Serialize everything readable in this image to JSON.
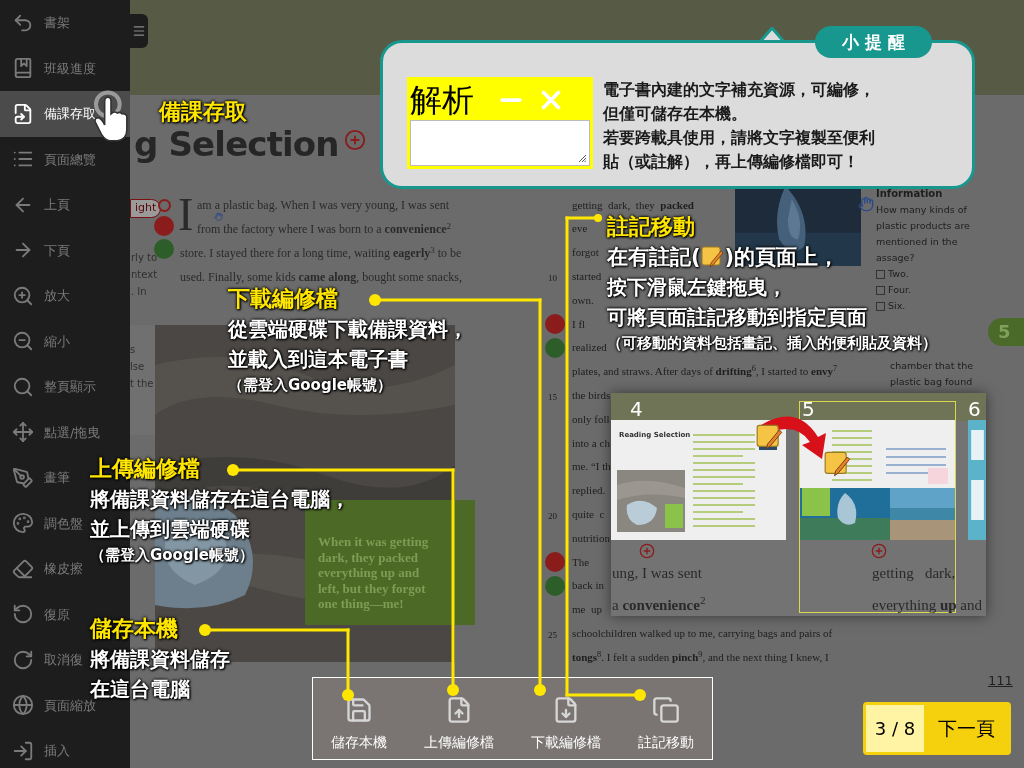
{
  "sidebar": {
    "items": [
      {
        "label": "書架",
        "selected": false
      },
      {
        "label": "班級進度",
        "selected": false
      },
      {
        "label": "備課存取",
        "selected": true
      },
      {
        "label": "頁面總覽",
        "selected": false
      },
      {
        "label": "上頁",
        "selected": false
      },
      {
        "label": "下頁",
        "selected": false
      },
      {
        "label": "放大",
        "selected": false
      },
      {
        "label": "縮小",
        "selected": false
      },
      {
        "label": "整頁顯示",
        "selected": false
      },
      {
        "label": "點選/拖曳",
        "selected": false
      },
      {
        "label": "畫筆",
        "selected": false
      },
      {
        "label": "調色盤",
        "selected": false
      },
      {
        "label": "橡皮擦",
        "selected": false
      },
      {
        "label": "復原",
        "selected": false
      },
      {
        "label": "取消復",
        "selected": false
      },
      {
        "label": "頁面縮放",
        "selected": false
      },
      {
        "label": "插入",
        "selected": false
      }
    ]
  },
  "pointer_label": "備課存取",
  "book": {
    "title": "g Selection",
    "tag": "ight",
    "left_fragments": [
      "rly to",
      "ntext",
      ". In"
    ],
    "side_box": [
      "s",
      "lse",
      "t the"
    ],
    "drop_cap": "I",
    "paragraph": [
      "am a plastic bag. When I was very young, I was sent",
      "from the factory where I was born to a **convenience**$^{2}$",
      "store. I stayed there for a long time, waiting **eagerly**$^{3}$ to be",
      "used. Finally, some kids **came along**, bought some snacks,"
    ],
    "quote": [
      "When it was getting",
      "dark, they packed",
      "everything up and",
      "left, but they forgot",
      "one thing—me!"
    ],
    "right_column": [
      {
        "text": "getting  dark,  they  **packed**"
      },
      {
        "text": "eve"
      },
      {
        "text": "forgot"
      },
      {
        "number": "10",
        "text": "started"
      },
      {
        "text": "own."
      },
      {
        "text": "I fl"
      },
      {
        "text": "realized"
      },
      {
        "text": "plates, and straws. After days of **drifting**$^{6}$, I started to **envy**$^{7}$"
      },
      {
        "number": "15",
        "text": "the birds"
      },
      {
        "text": "only foll"
      },
      {
        "text": "into a ch"
      },
      {
        "text": "me. “I th"
      },
      {
        "text": "replied."
      },
      {
        "number": "20",
        "text": "quite  c"
      },
      {
        "text": "nutrition"
      },
      {
        "text": "The"
      },
      {
        "text": "back in"
      },
      {
        "text": "me  up"
      },
      {
        "number": "25",
        "text": "schoolchildren walked up to me, carrying bags and pairs of"
      },
      {
        "text": "**tongs**$^{8}$. I felt a sudden **pinch**$^{9}$, and the next thing I knew, I"
      }
    ],
    "info": {
      "heading": "Information",
      "question": [
        "How many kinds of",
        "plastic products are",
        "mentioned in the",
        "assage?"
      ],
      "options": [
        {
          "label": "Two.",
          "checked": false
        },
        {
          "label": "Four.",
          "checked": false
        },
        {
          "label": "Six.",
          "checked": false
        }
      ],
      "more": [
        "chamber that the",
        "plastic bag found"
      ]
    },
    "chapter_tab": "5",
    "page_number": "111"
  },
  "tip": {
    "badge": "小 提 醒",
    "note_title": "解析",
    "lines": [
      "電子書內建的文字補充資源，可編修，",
      "但僅可儲存在本機。",
      "若要跨載具使用，請將文字複製至便利",
      "貼（或註解），再上傳編修檔即可！"
    ]
  },
  "callouts": [
    {
      "kind": "download",
      "title": "下載編修檔",
      "lines": [
        "從雲端硬碟下載備課資料，",
        "並載入到這本電子書"
      ],
      "note": "（需登入Google帳號）"
    },
    {
      "kind": "upload",
      "title": "上傳編修檔",
      "lines": [
        "將備課資料儲存在這台電腦，",
        "並上傳到雲端硬碟"
      ],
      "note": "（需登入Google帳號）"
    },
    {
      "kind": "save",
      "title": "儲存本機",
      "lines": [
        "將備課資料儲存",
        "在這台電腦"
      ]
    },
    {
      "kind": "move",
      "title": "註記移動",
      "icon_line": {
        "before": "在有註記(",
        "after": ")的頁面上，"
      },
      "lines": [
        "按下滑鼠左鍵拖曳，",
        "可將頁面註記移動到指定頁面"
      ],
      "note": "（可移動的資料包括畫記、插入的便利貼及資料）"
    }
  ],
  "preview": {
    "pages": [
      "4",
      "5",
      "6"
    ],
    "thumb_title": "Reading Selection",
    "left_text": [
      "ung, I was sent",
      "a **convenience**$^{2}$"
    ],
    "right_text": [
      "getting   dark,",
      "everything **up** and"
    ]
  },
  "toolbar": [
    {
      "kind": "save",
      "label": "儲存本機"
    },
    {
      "kind": "upload",
      "label": "上傳編修檔"
    },
    {
      "kind": "download",
      "label": "下載編修檔"
    },
    {
      "kind": "move",
      "label": "註記移動"
    }
  ],
  "steps": {
    "counter": "3 / 8",
    "next": "下一頁"
  }
}
